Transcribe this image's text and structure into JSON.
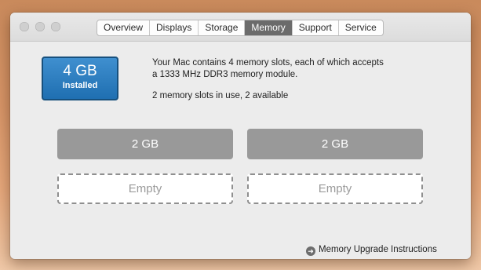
{
  "tabs": [
    {
      "label": "Overview",
      "active": false
    },
    {
      "label": "Displays",
      "active": false
    },
    {
      "label": "Storage",
      "active": false
    },
    {
      "label": "Memory",
      "active": true
    },
    {
      "label": "Support",
      "active": false
    },
    {
      "label": "Service",
      "active": false
    }
  ],
  "memory": {
    "installed_amount": "4 GB",
    "installed_label": "Installed",
    "description_line1": "Your Mac contains 4 memory slots, each of which accepts",
    "description_line2": "a 1333 MHz DDR3 memory module.",
    "usage": "2 memory slots in use, 2 available",
    "slots": [
      {
        "label": "2 GB",
        "state": "filled"
      },
      {
        "label": "2 GB",
        "state": "filled"
      },
      {
        "label": "Empty",
        "state": "empty"
      },
      {
        "label": "Empty",
        "state": "empty"
      }
    ],
    "upgrade_link": "Memory Upgrade Instructions",
    "upgrade_icon": "arrow-circle-right-icon"
  },
  "colors": {
    "installed_badge": "#2f80c2",
    "slot_filled": "#999999",
    "active_tab": "#6b6b6b"
  }
}
